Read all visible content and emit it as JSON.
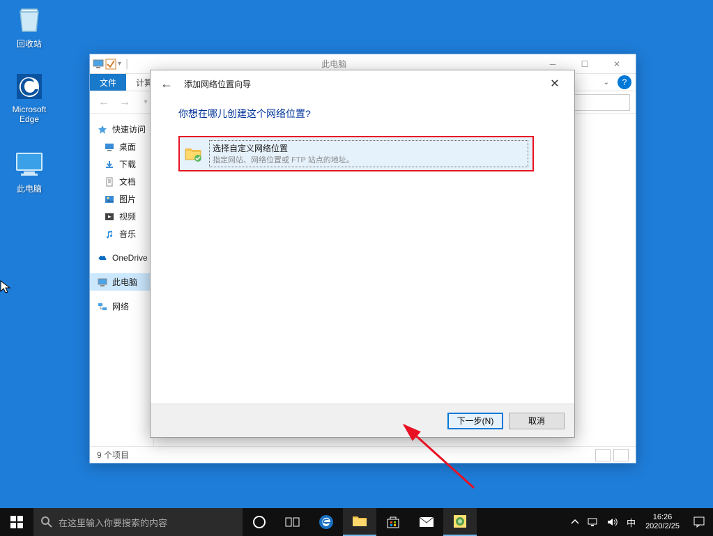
{
  "desktop": {
    "recycle": "回收站",
    "edge": "Microsoft Edge",
    "thispc": "此电脑"
  },
  "explorer": {
    "title": "此电脑",
    "tabs": {
      "file": "文件",
      "computer": "计算"
    },
    "help": "?",
    "sidebar": {
      "quick": "快速访问",
      "desktop": "桌面",
      "downloads": "下载",
      "documents": "文档",
      "pictures": "图片",
      "videos": "视频",
      "music": "音乐",
      "onedrive": "OneDrive",
      "thispc": "此电脑",
      "network": "网络"
    },
    "status": "9 个项目"
  },
  "wizard": {
    "title": "添加网络位置向导",
    "heading": "你想在哪儿创建这个网络位置?",
    "option_title": "选择自定义网络位置",
    "option_desc": "指定网站、网络位置或 FTP 站点的地址。",
    "next": "下一步(N)",
    "cancel": "取消"
  },
  "taskbar": {
    "search_placeholder": "在这里输入你要搜索的内容",
    "ime": "中",
    "time": "16:26",
    "date": "2020/2/25"
  }
}
